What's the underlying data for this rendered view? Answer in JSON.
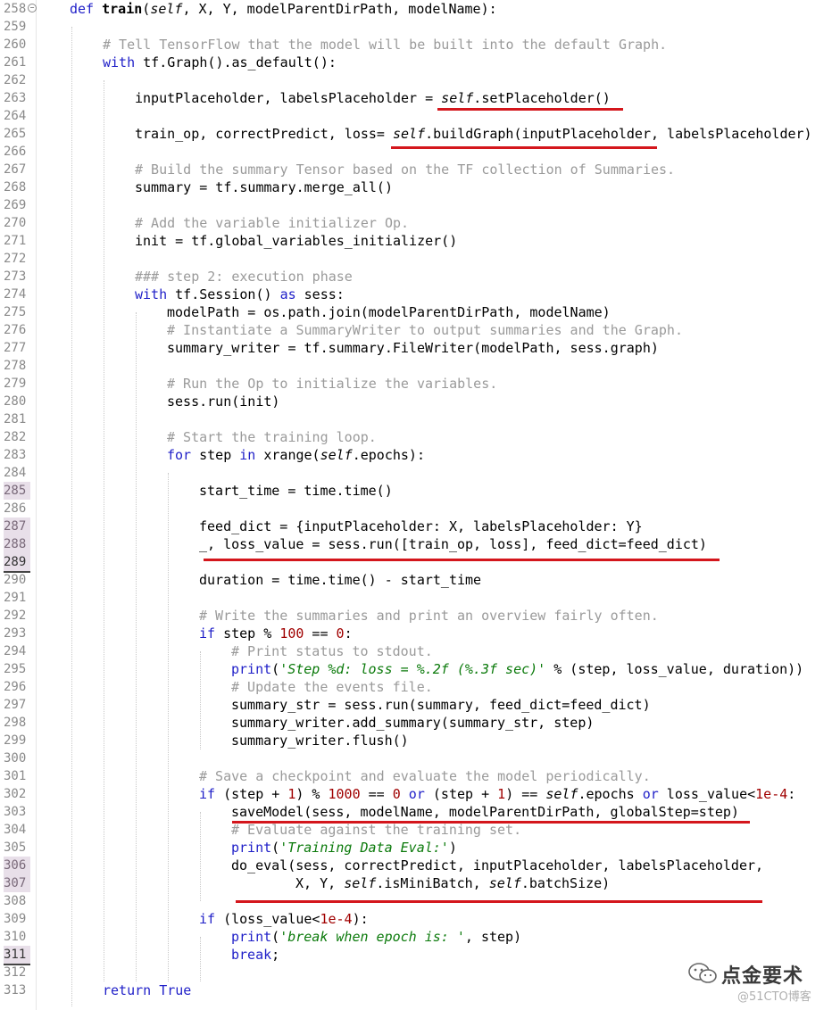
{
  "editor": {
    "line_numbers": [
      "258",
      "259",
      "260",
      "261",
      "262",
      "263",
      "264",
      "265",
      "266",
      "267",
      "268",
      "269",
      "270",
      "271",
      "272",
      "273",
      "274",
      "275",
      "276",
      "277",
      "278",
      "279",
      "280",
      "281",
      "282",
      "283",
      "284",
      "285",
      "286",
      "287",
      "288",
      "289",
      "290",
      "291",
      "292",
      "293",
      "294",
      "295",
      "296",
      "297",
      "298",
      "299",
      "300",
      "301",
      "302",
      "303",
      "304",
      "305",
      "306",
      "307",
      "308",
      "309",
      "310",
      "311",
      "312",
      "313"
    ],
    "lines": {
      "l258": {
        "kw": "def ",
        "name": "train",
        "rest1": "(",
        "self": "self",
        "rest2": ", X, Y, modelParentDirPath, modelName):"
      },
      "l260": {
        "cm": "# Tell TensorFlow that the model will be built into the default Graph."
      },
      "l261": {
        "kw": "with",
        "rest": " tf.Graph().as_default():"
      },
      "l263": {
        "a": "inputPlaceholder, labelsPlaceholder = ",
        "self": "self",
        "b": ".setPlaceholder()"
      },
      "l265": {
        "a": "train_op, correctPredict, loss= ",
        "self": "self",
        "b": ".buildGraph(inputPlaceholder, labelsPlaceholder)"
      },
      "l267": {
        "cm": "# Build the summary Tensor based on the TF collection of Summaries."
      },
      "l268": {
        "a": "summary = tf.summary.merge_all()"
      },
      "l270": {
        "cm": "# Add the variable initializer Op."
      },
      "l271": {
        "a": "init = tf.global_variables_initializer()"
      },
      "l273": {
        "cm": "### step 2: execution phase"
      },
      "l274": {
        "kw": "with",
        "a": " tf.Session() ",
        "kw2": "as",
        "b": " sess:"
      },
      "l275": {
        "a": "modelPath = os.path.join(modelParentDirPath, modelName)"
      },
      "l276": {
        "cm": "# Instantiate a SummaryWriter to output summaries and the Graph."
      },
      "l277": {
        "a": "summary_writer = tf.summary.FileWriter(modelPath, sess.graph)"
      },
      "l279": {
        "cm": "# Run the Op to initialize the variables."
      },
      "l280": {
        "a": "sess.run(init)"
      },
      "l282": {
        "cm": "# Start the training loop."
      },
      "l283": {
        "kw": "for",
        "a": " step ",
        "kw2": "in",
        "b": " xrange(",
        "self": "self",
        "c": ".epochs):"
      },
      "l285": {
        "a": "start_time = time.time()"
      },
      "l287": {
        "a": "feed_dict = {inputPlaceholder: X, labelsPlaceholder: Y}"
      },
      "l288": {
        "a": "_, loss_value = sess.run([train_op, loss], feed_dict=feed_dict)"
      },
      "l290": {
        "a": "duration = time.time() - start_time"
      },
      "l292": {
        "cm": "# Write the summaries and print an overview fairly often."
      },
      "l293": {
        "kw": "if",
        "a": " step % ",
        "num": "100",
        "b": " == ",
        "num2": "0",
        "c": ":"
      },
      "l294": {
        "cm": "# Print status to stdout."
      },
      "l295": {
        "kw": "print",
        "a": "(",
        "str": "'Step %d: loss = %.2f (%.3f sec)'",
        "b": " % (step, loss_value, duration))"
      },
      "l296": {
        "cm": "# Update the events file."
      },
      "l297": {
        "a": "summary_str = sess.run(summary, feed_dict=feed_dict)"
      },
      "l298": {
        "a": "summary_writer.add_summary(summary_str, step)"
      },
      "l299": {
        "a": "summary_writer.flush()"
      },
      "l301": {
        "cm": "# Save a checkpoint and evaluate the model periodically."
      },
      "l302": {
        "kw": "if",
        "a": " (step + ",
        "num": "1",
        "b": ") % ",
        "num2": "1000",
        "c": " == ",
        "num3": "0",
        "kw2": " or",
        "d": " (step + ",
        "num4": "1",
        "e": ") == ",
        "self": "self",
        "f": ".epochs ",
        "kw3": "or",
        "g": " loss_value<",
        "num5": "1e-4",
        "h": ":"
      },
      "l303": {
        "a": "saveModel(sess, modelName, modelParentDirPath, globalStep=step)"
      },
      "l304": {
        "cm": "# Evaluate against the training set."
      },
      "l305": {
        "kw": "print",
        "a": "(",
        "str": "'Training Data Eval:'",
        "b": ")"
      },
      "l306": {
        "a": "do_eval(sess, correctPredict, inputPlaceholder, labelsPlaceholder,"
      },
      "l307": {
        "a": "X, Y, ",
        "self": "self",
        "b": ".isMiniBatch, ",
        "self2": "self",
        "c": ".batchSize)"
      },
      "l309": {
        "kw": "if",
        "a": " (loss_value<",
        "num": "1e-4",
        "b": "):"
      },
      "l310": {
        "kw": "print",
        "a": "(",
        "str": "'break when epoch is: '",
        "b": ", step)"
      },
      "l311": {
        "kw": "break",
        "a": ";"
      },
      "l313": {
        "kw": "return",
        "a": " ",
        "kw2": "True"
      }
    }
  },
  "watermark": {
    "title": "点金要术",
    "sub": "@51CTO博客"
  },
  "colors": {
    "keyword": "#1f1fc8",
    "comment": "#9a9a9a",
    "number": "#a00000",
    "string": "#0b7a0b",
    "underline": "#d4161c"
  }
}
